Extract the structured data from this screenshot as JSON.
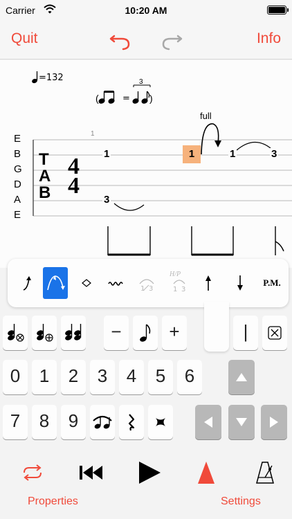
{
  "status": {
    "carrier": "Carrier",
    "time": "10:20 AM"
  },
  "nav": {
    "quit_label": "Quit",
    "info_label": "Info"
  },
  "score": {
    "tempo": "=132",
    "swing_eq": "=",
    "triplet": "3",
    "measure_number": "1",
    "string_labels": [
      "E",
      "B",
      "G",
      "D",
      "A",
      "E"
    ],
    "clef_letters": [
      "T",
      "A",
      "B"
    ],
    "time_signature": {
      "top": "4",
      "bottom": "4"
    },
    "frets": [
      "1",
      "1",
      "1",
      "3",
      "3"
    ],
    "bend_label": "full"
  },
  "effects": {
    "palm_mute": "P.M.",
    "hp": "H/P"
  },
  "keyboard": {
    "minus": "−",
    "plus": "+",
    "bar": "|",
    "digits_row1": [
      "0",
      "1",
      "2",
      "3",
      "4",
      "5",
      "6"
    ],
    "digits_row2": [
      "7",
      "8",
      "9"
    ]
  },
  "bottom": {
    "properties_label": "Properties",
    "settings_label": "Settings"
  },
  "colors": {
    "accent": "#f04a3a",
    "selected_note": "#f6b27c",
    "active_tool": "#1a73e8"
  }
}
